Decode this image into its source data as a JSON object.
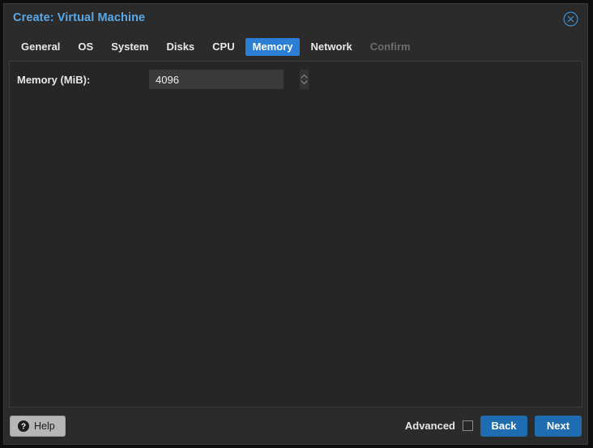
{
  "dialog": {
    "title": "Create: Virtual Machine",
    "close_icon": "close-circle-icon"
  },
  "tabs": [
    {
      "label": "General",
      "state": "normal"
    },
    {
      "label": "OS",
      "state": "normal"
    },
    {
      "label": "System",
      "state": "normal"
    },
    {
      "label": "Disks",
      "state": "normal"
    },
    {
      "label": "CPU",
      "state": "normal"
    },
    {
      "label": "Memory",
      "state": "active"
    },
    {
      "label": "Network",
      "state": "normal"
    },
    {
      "label": "Confirm",
      "state": "disabled"
    }
  ],
  "form": {
    "memory_label": "Memory (MiB):",
    "memory_value": "4096",
    "spinner_up_icon": "chevron-up-icon",
    "spinner_down_icon": "chevron-down-icon"
  },
  "footer": {
    "help_label": "Help",
    "help_icon": "question-circle-icon",
    "advanced_label": "Advanced",
    "advanced_checked": false,
    "back_label": "Back",
    "next_label": "Next"
  },
  "colors": {
    "accent_blue": "#2a7fd4",
    "button_blue": "#1f6cb0",
    "title_blue": "#5aa9e6",
    "dialog_bg": "#2b2b2b",
    "content_bg": "#262626",
    "input_bg": "#3a3a3a",
    "help_bg": "#b6b6b6"
  }
}
